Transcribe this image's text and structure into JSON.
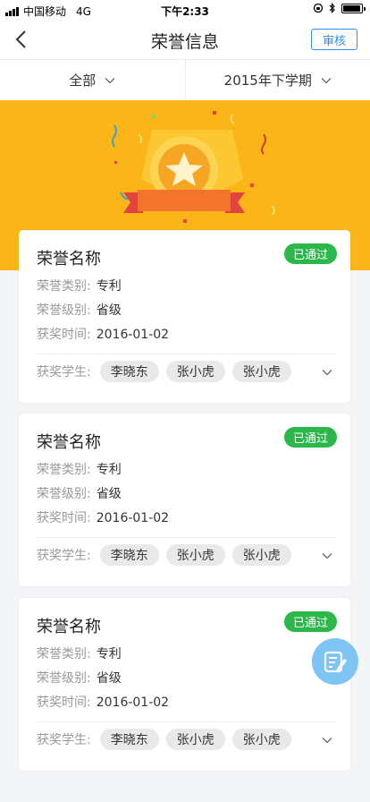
{
  "status_bar": {
    "carrier": "中国移动",
    "network": "4G",
    "time": "下午2:33"
  },
  "nav": {
    "title": "荣誉信息",
    "action_label": "审核"
  },
  "filters": [
    {
      "label": "全部"
    },
    {
      "label": "2015年下学期"
    }
  ],
  "colors": {
    "banner": "#fbb519",
    "badge": "#2bb74a",
    "accent": "#2d8ff0",
    "fab": "#7ec4f5"
  },
  "cards": [
    {
      "title": "荣誉名称",
      "status": "已通过",
      "category_label": "荣誉类别:",
      "category": "专利",
      "level_label": "荣誉级别:",
      "level": "省级",
      "date_label": "获奖时间:",
      "date": "2016-01-02",
      "students_label": "获奖学生:",
      "students": [
        "李晓东",
        "张小虎",
        "张小虎"
      ]
    },
    {
      "title": "荣誉名称",
      "status": "已通过",
      "category_label": "荣誉类别:",
      "category": "专利",
      "level_label": "荣誉级别:",
      "level": "省级",
      "date_label": "获奖时间:",
      "date": "2016-01-02",
      "students_label": "获奖学生:",
      "students": [
        "李晓东",
        "张小虎",
        "张小虎"
      ]
    },
    {
      "title": "荣誉名称",
      "status": "已通过",
      "category_label": "荣誉类别:",
      "category": "专利",
      "level_label": "荣誉级别:",
      "level": "省级",
      "date_label": "获奖时间:",
      "date": "2016-01-02",
      "students_label": "获奖学生:",
      "students": [
        "李晓东",
        "张小虎",
        "张小虎"
      ]
    }
  ],
  "icons": {
    "back": "chevron-left-icon",
    "dropdown": "chevron-down-icon",
    "expand": "chevron-down-icon",
    "fab": "edit-note-icon",
    "banner": "medal-star-icon"
  }
}
